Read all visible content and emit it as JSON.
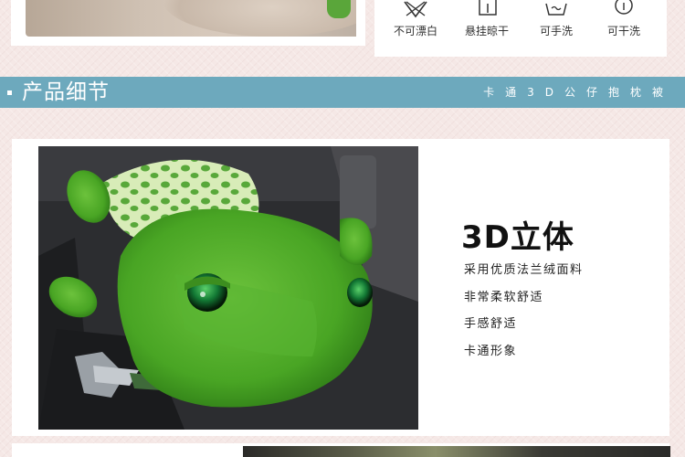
{
  "care_instructions": [
    {
      "label": "不可漂白",
      "icon": "no-bleach-icon"
    },
    {
      "label": "悬挂晾干",
      "icon": "hang-dry-icon"
    },
    {
      "label": "可手洗",
      "icon": "hand-wash-icon"
    },
    {
      "label": "可干洗",
      "icon": "dry-clean-icon"
    }
  ],
  "section": {
    "title": "产品细节",
    "subtitle": "卡通3D公仔抱枕被"
  },
  "feature": {
    "heading": "3D立体",
    "points": [
      "采用优质法兰绒面料",
      "非常柔软舒适",
      "手感舒适",
      "卡通形象"
    ]
  },
  "colors": {
    "header_bar": "#6da9bd",
    "page_background": "#f5e8e6",
    "plush_green": "#4fae2c"
  }
}
